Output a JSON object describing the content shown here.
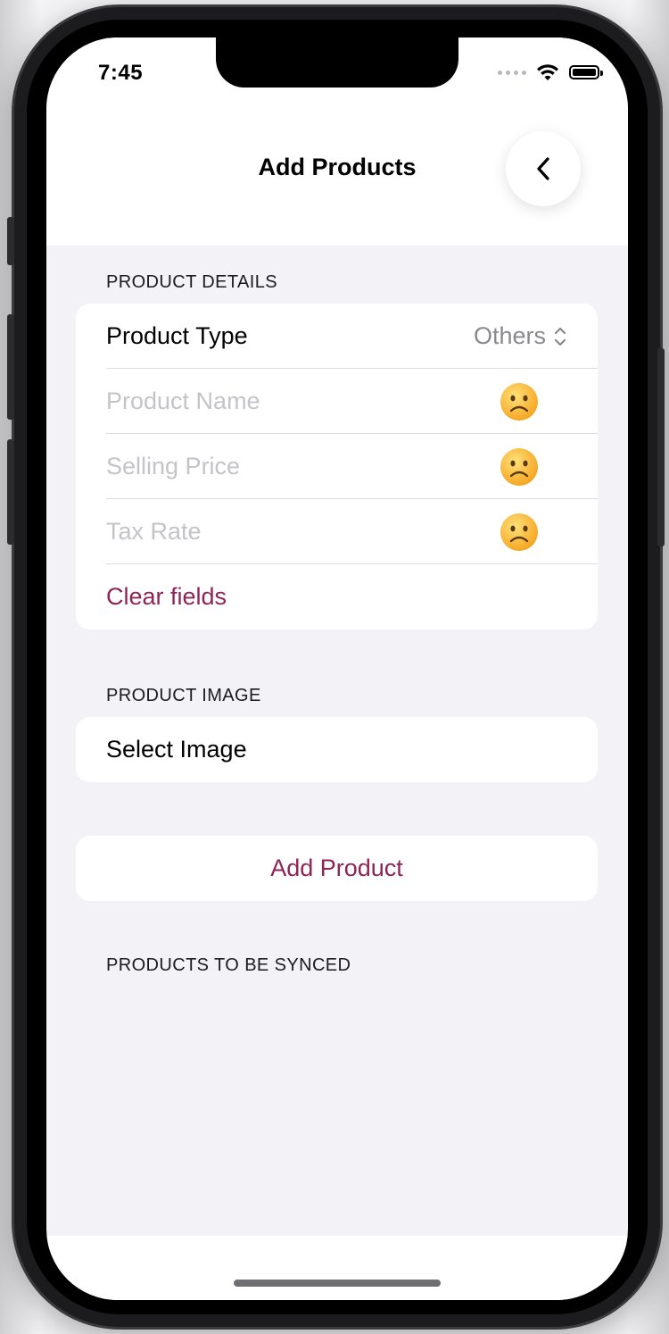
{
  "status_bar": {
    "time": "7:45"
  },
  "nav": {
    "title": "Add Products",
    "back_icon": "chevron-left-icon"
  },
  "product_details": {
    "header": "PRODUCT DETAILS",
    "product_type_label": "Product Type",
    "product_type_value": "Others",
    "product_name_placeholder": "Product Name",
    "selling_price_placeholder": "Selling Price",
    "tax_rate_placeholder": "Tax Rate",
    "status_icon": "frowning-face-icon",
    "clear_label": "Clear fields"
  },
  "product_image": {
    "header": "PRODUCT IMAGE",
    "select_label": "Select Image"
  },
  "actions": {
    "add_product_label": "Add Product"
  },
  "sync": {
    "header": "PRODUCTS TO BE SYNCED"
  },
  "colors": {
    "accent": "#8e2457",
    "grouped_background": "#f2f2f7",
    "placeholder": "#c4c4c8"
  }
}
